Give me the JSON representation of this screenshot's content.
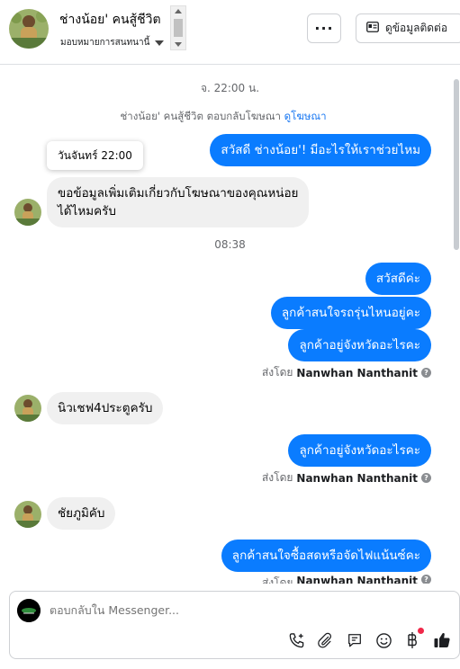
{
  "header": {
    "name": "ช่างน้อย' คนสู้ชีวิต",
    "assign_label": "มอบหมายการสนทนานี้",
    "more_label": "···",
    "contact_label": "ดูข้อมูลติดต่อ"
  },
  "conversation": {
    "timestamp_1": "จ. 22:00 น.",
    "reply_meta_prefix": "ช่างน้อย' คนสู้ชีวิต ตอบกลับโฆษณา",
    "reply_meta_link": "ดูโฆษณา",
    "tooltip": "วันจันทร์ 22:00",
    "messages": [
      {
        "direction": "out",
        "text": "สวัสดี ช่างน้อย'! มีอะไรให้เราช่วยไหม"
      },
      {
        "direction": "in",
        "text": "ขอข้อมูลเพิ่มเติมเกี่ยวกับโฆษณาของคุณหน่อย\nได้ไหมครับ"
      },
      {
        "direction": "out",
        "text": "สวัสดีค่ะ"
      },
      {
        "direction": "out",
        "text": "ลูกค้าสนใจรถรุ่นไหนอยู่คะ"
      },
      {
        "direction": "out",
        "text": "ลูกค้าอยู่จังหวัดอะไรคะ"
      },
      {
        "direction": "in",
        "text": "นิวเชฟ4ประตูครับ"
      },
      {
        "direction": "out",
        "text": "ลูกค้าอยู่จังหวัดอะไรคะ"
      },
      {
        "direction": "in",
        "text": "ชัยภูมิคับ"
      },
      {
        "direction": "out",
        "text": "ลูกค้าสนใจซื้อสดหรือจัดไฟแน้นซ์คะ"
      }
    ],
    "timestamp_2": "08:38",
    "sent_by_prefix": "ส่งโดย",
    "sent_by_name": "Nanwhan Nanthanit"
  },
  "composer": {
    "placeholder": "ตอบกลับใน Messenger..."
  },
  "colors": {
    "accent": "#0a7cff",
    "incoming_bubble": "#f0f0f0",
    "link": "#1877f2",
    "notification": "#f02849"
  }
}
